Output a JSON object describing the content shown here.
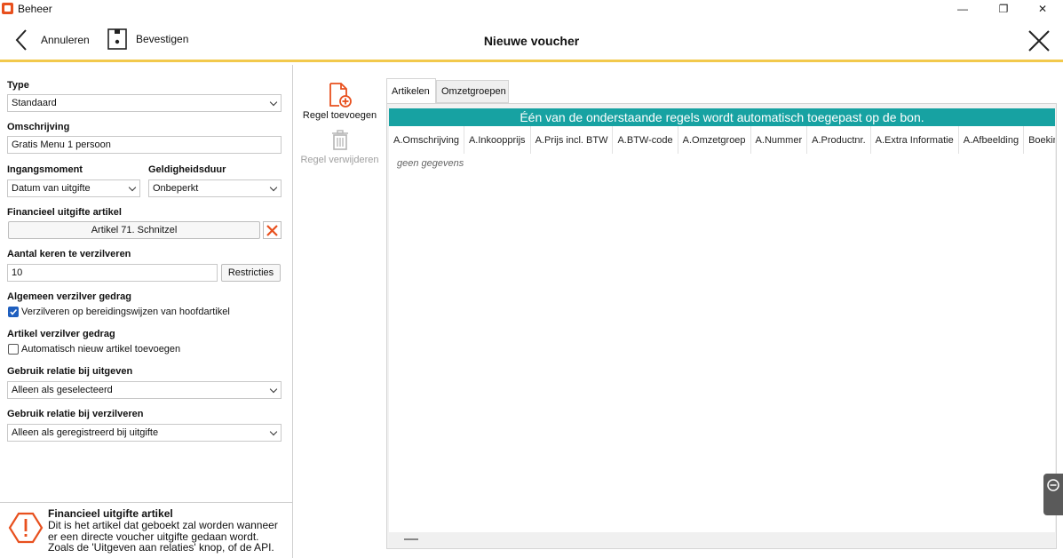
{
  "window": {
    "title": "Beheer",
    "minimize_glyph": "—",
    "maximize_glyph": "❐",
    "close_glyph": "✕"
  },
  "toolbar": {
    "cancel_label": "Annuleren",
    "confirm_label": "Bevestigen",
    "page_title": "Nieuwe voucher"
  },
  "form": {
    "type_label": "Type",
    "type_value": "Standaard",
    "description_label": "Omschrijving",
    "description_value": "Gratis Menu 1 persoon",
    "start_label": "Ingangsmoment",
    "start_value": "Datum van uitgifte",
    "validity_label": "Geldigheidsduur",
    "validity_value": "Onbeperkt",
    "fin_article_label": "Financieel uitgifte artikel",
    "fin_article_value": "Artikel 71. Schnitzel",
    "redeem_count_label": "Aantal keren te verzilveren",
    "redeem_count_value": "10",
    "restrictions_label": "Restricties",
    "general_behaviour_label": "Algemeen verzilver gedrag",
    "general_behaviour_checkbox": "Verzilveren op bereidingswijzen van hoofdartikel",
    "general_behaviour_checked": true,
    "article_behaviour_label": "Artikel verzilver gedrag",
    "article_behaviour_checkbox": "Automatisch nieuw artikel toevoegen",
    "article_behaviour_checked": false,
    "relation_issue_label": "Gebruik relatie bij uitgeven",
    "relation_issue_value": "Alleen als geselecteerd",
    "relation_redeem_label": "Gebruik relatie bij verzilveren",
    "relation_redeem_value": "Alleen als geregistreerd bij uitgifte"
  },
  "info": {
    "title": "Financieel uitgifte artikel",
    "text": "Dit is het artikel dat geboekt zal worden wanneer er een directe voucher uitgifte gedaan wordt. Zoals de 'Uitgeven aan relaties' knop, of de API."
  },
  "actions": {
    "add_label": "Regel toevoegen",
    "remove_label": "Regel verwijderen"
  },
  "tabs": [
    "Artikelen",
    "Omzetgroepen"
  ],
  "grid": {
    "banner": "Één van de onderstaande regels wordt automatisch toegepast op de bon.",
    "columns": [
      "A.Omschrijving",
      "A.Inkoopprijs",
      "A.Prijs incl. BTW",
      "A.BTW-code",
      "A.Omzetgroep",
      "A.Nummer",
      "A.Productnr.",
      "A.Extra Informatie",
      "A.Afbeelding",
      "Boekin"
    ],
    "empty_text": "geen gegevens"
  },
  "colors": {
    "accent_orange": "#e8501e",
    "toolbar_underline": "#f2c94c",
    "banner_teal": "#17a2a2",
    "checkbox_blue": "#1f5fbf"
  }
}
